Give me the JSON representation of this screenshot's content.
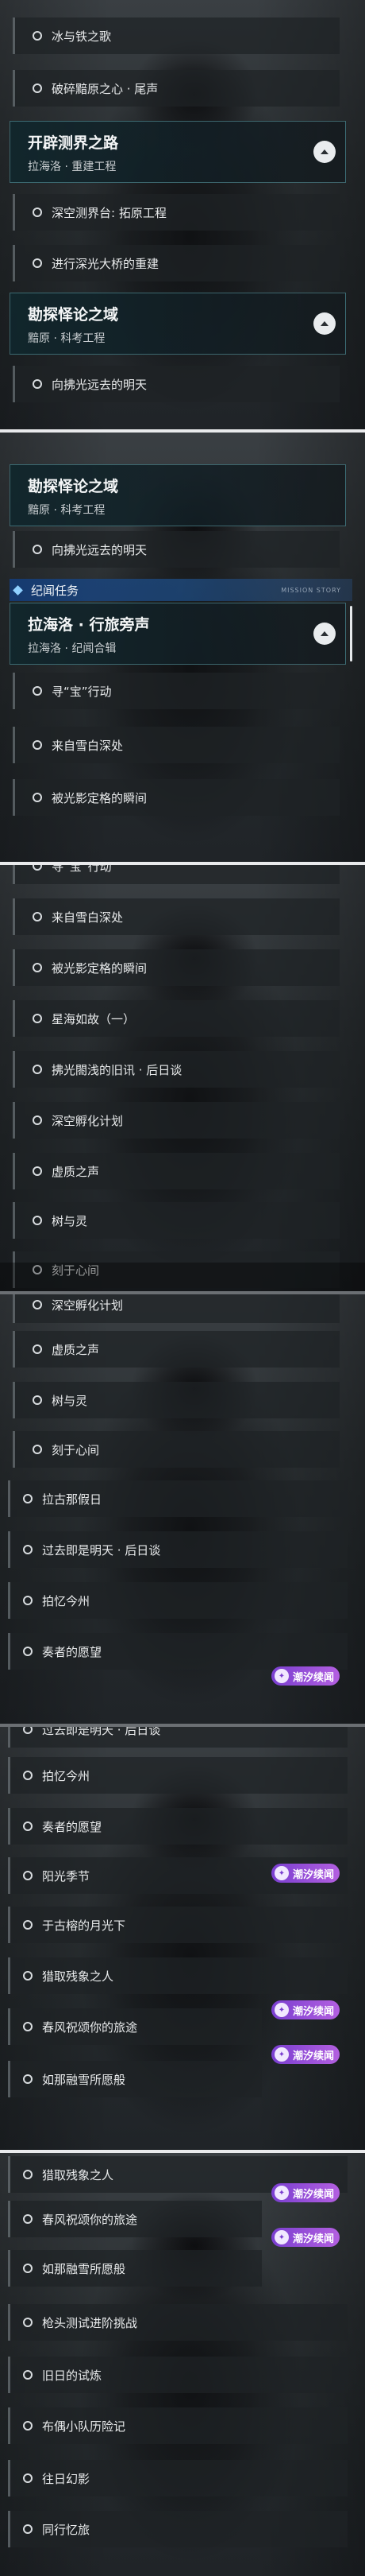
{
  "shots": [
    {
      "groups": [
        {
          "title": "开辟测界之路",
          "sub": "拉海洛 · 重建工程"
        },
        {
          "title": "勘探怿论之域",
          "sub": "黯原 · 科考工程"
        }
      ],
      "rows": [
        "冰与铁之歌",
        "破碎黯原之心 · 尾声",
        "深空测界台: 拓原工程",
        "进行深光大桥的重建",
        "向拂光远去的明天"
      ]
    },
    {
      "groups": [
        {
          "title": "勘探怿论之域",
          "sub": "黯原 · 科考工程"
        },
        {
          "title": "拉海洛 · 行旅旁声",
          "sub": "拉海洛 · 纪闻合辑"
        }
      ],
      "section": {
        "label": "纪闻任务",
        "eng": "MISSION STORY"
      },
      "rows": [
        "向拂光远去的明天",
        "寻“宝”行动",
        "来自雪白深处",
        "被光影定格的瞬间"
      ]
    },
    {
      "rows": [
        "寻“宝”行动",
        "来自雪白深处",
        "被光影定格的瞬间",
        "星海如故（一）",
        "拂光閤浅的旧讯 · 后日谈",
        "深空孵化计划",
        "虚质之声",
        "树与灵",
        "刻于心间"
      ]
    },
    {
      "rows": [
        "深空孵化计划",
        "虚质之声",
        "树与灵",
        "刻于心间",
        "拉古那假日",
        "过去即是明天 · 后日谈",
        "拍忆今州",
        "奏者的愿望"
      ],
      "badge": "潮汐续闻"
    },
    {
      "rows": [
        "过去即是明天 · 后日谈",
        "拍忆今州",
        "奏者的愿望",
        "阳光季节",
        "于古榕的月光下",
        "猎取残象之人",
        "春风祝颂你的旅途",
        "如那融雪所愿般"
      ],
      "badge": "潮汐续闻"
    },
    {
      "rows": [
        "猎取残象之人",
        "春风祝颂你的旅途",
        "如那融雪所愿般",
        "枪头测试进阶挑战",
        "旧日的试炼",
        "布偶小队历险记",
        "往日幻影",
        "同行忆旅"
      ],
      "badge": "潮汐续闻"
    }
  ]
}
